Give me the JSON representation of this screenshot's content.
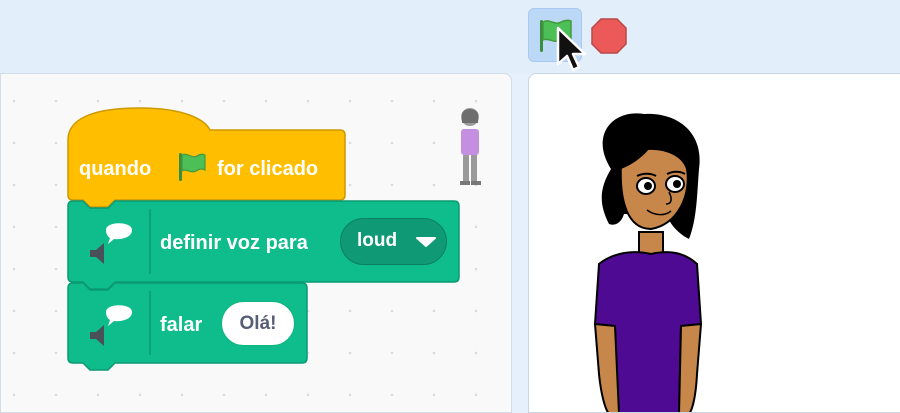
{
  "toolbar": {
    "green_flag": "green-flag-icon",
    "stop": "stop-sign-icon"
  },
  "colors": {
    "events": "#ffbf00",
    "text2speech": "#0fbd8c",
    "stop": "#ec5959",
    "flag": "#4cbf56"
  },
  "blocks": {
    "hat": {
      "before": "quando",
      "after": "for clicado"
    },
    "set_voice": {
      "label": "definir voz para",
      "value": "loud"
    },
    "speak": {
      "label": "falar",
      "value": "Olá!"
    }
  }
}
